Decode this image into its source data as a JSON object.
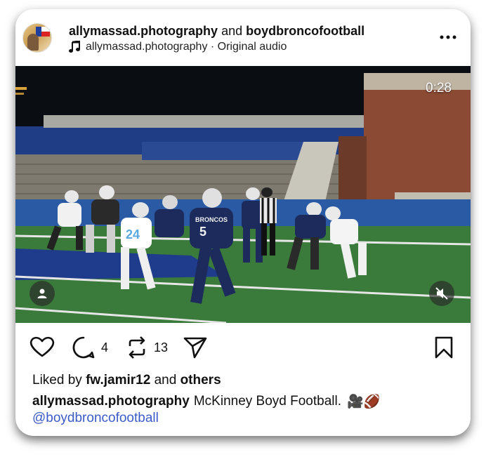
{
  "post": {
    "author": "allymassad.photography",
    "connector": "and",
    "coauthor": "boydbroncofootball",
    "audio_label": "allymassad.photography · Original audio",
    "avatar_label": "profile photo"
  },
  "video": {
    "time_remaining": "0:28",
    "jersey_text": "BRONCOS"
  },
  "actions": {
    "comment_count": "4",
    "repost_count": "13"
  },
  "likes": {
    "prefix": "Liked by",
    "user": "fw.jamir12",
    "connector": "and",
    "others": "others"
  },
  "caption": {
    "username": "allymassad.photography",
    "text": "McKinney Boyd Football.",
    "emoji": "🎥🏈",
    "mention": "@boydbroncofootball"
  },
  "colors": {
    "mention": "#3b5bc8",
    "text": "#111111",
    "card_bg": "#ffffff"
  },
  "icons": [
    "more-icon",
    "music-note-icon",
    "user-tag-icon",
    "muted-speaker-icon",
    "heart-icon",
    "comment-icon",
    "repost-icon",
    "share-icon",
    "bookmark-icon"
  ]
}
